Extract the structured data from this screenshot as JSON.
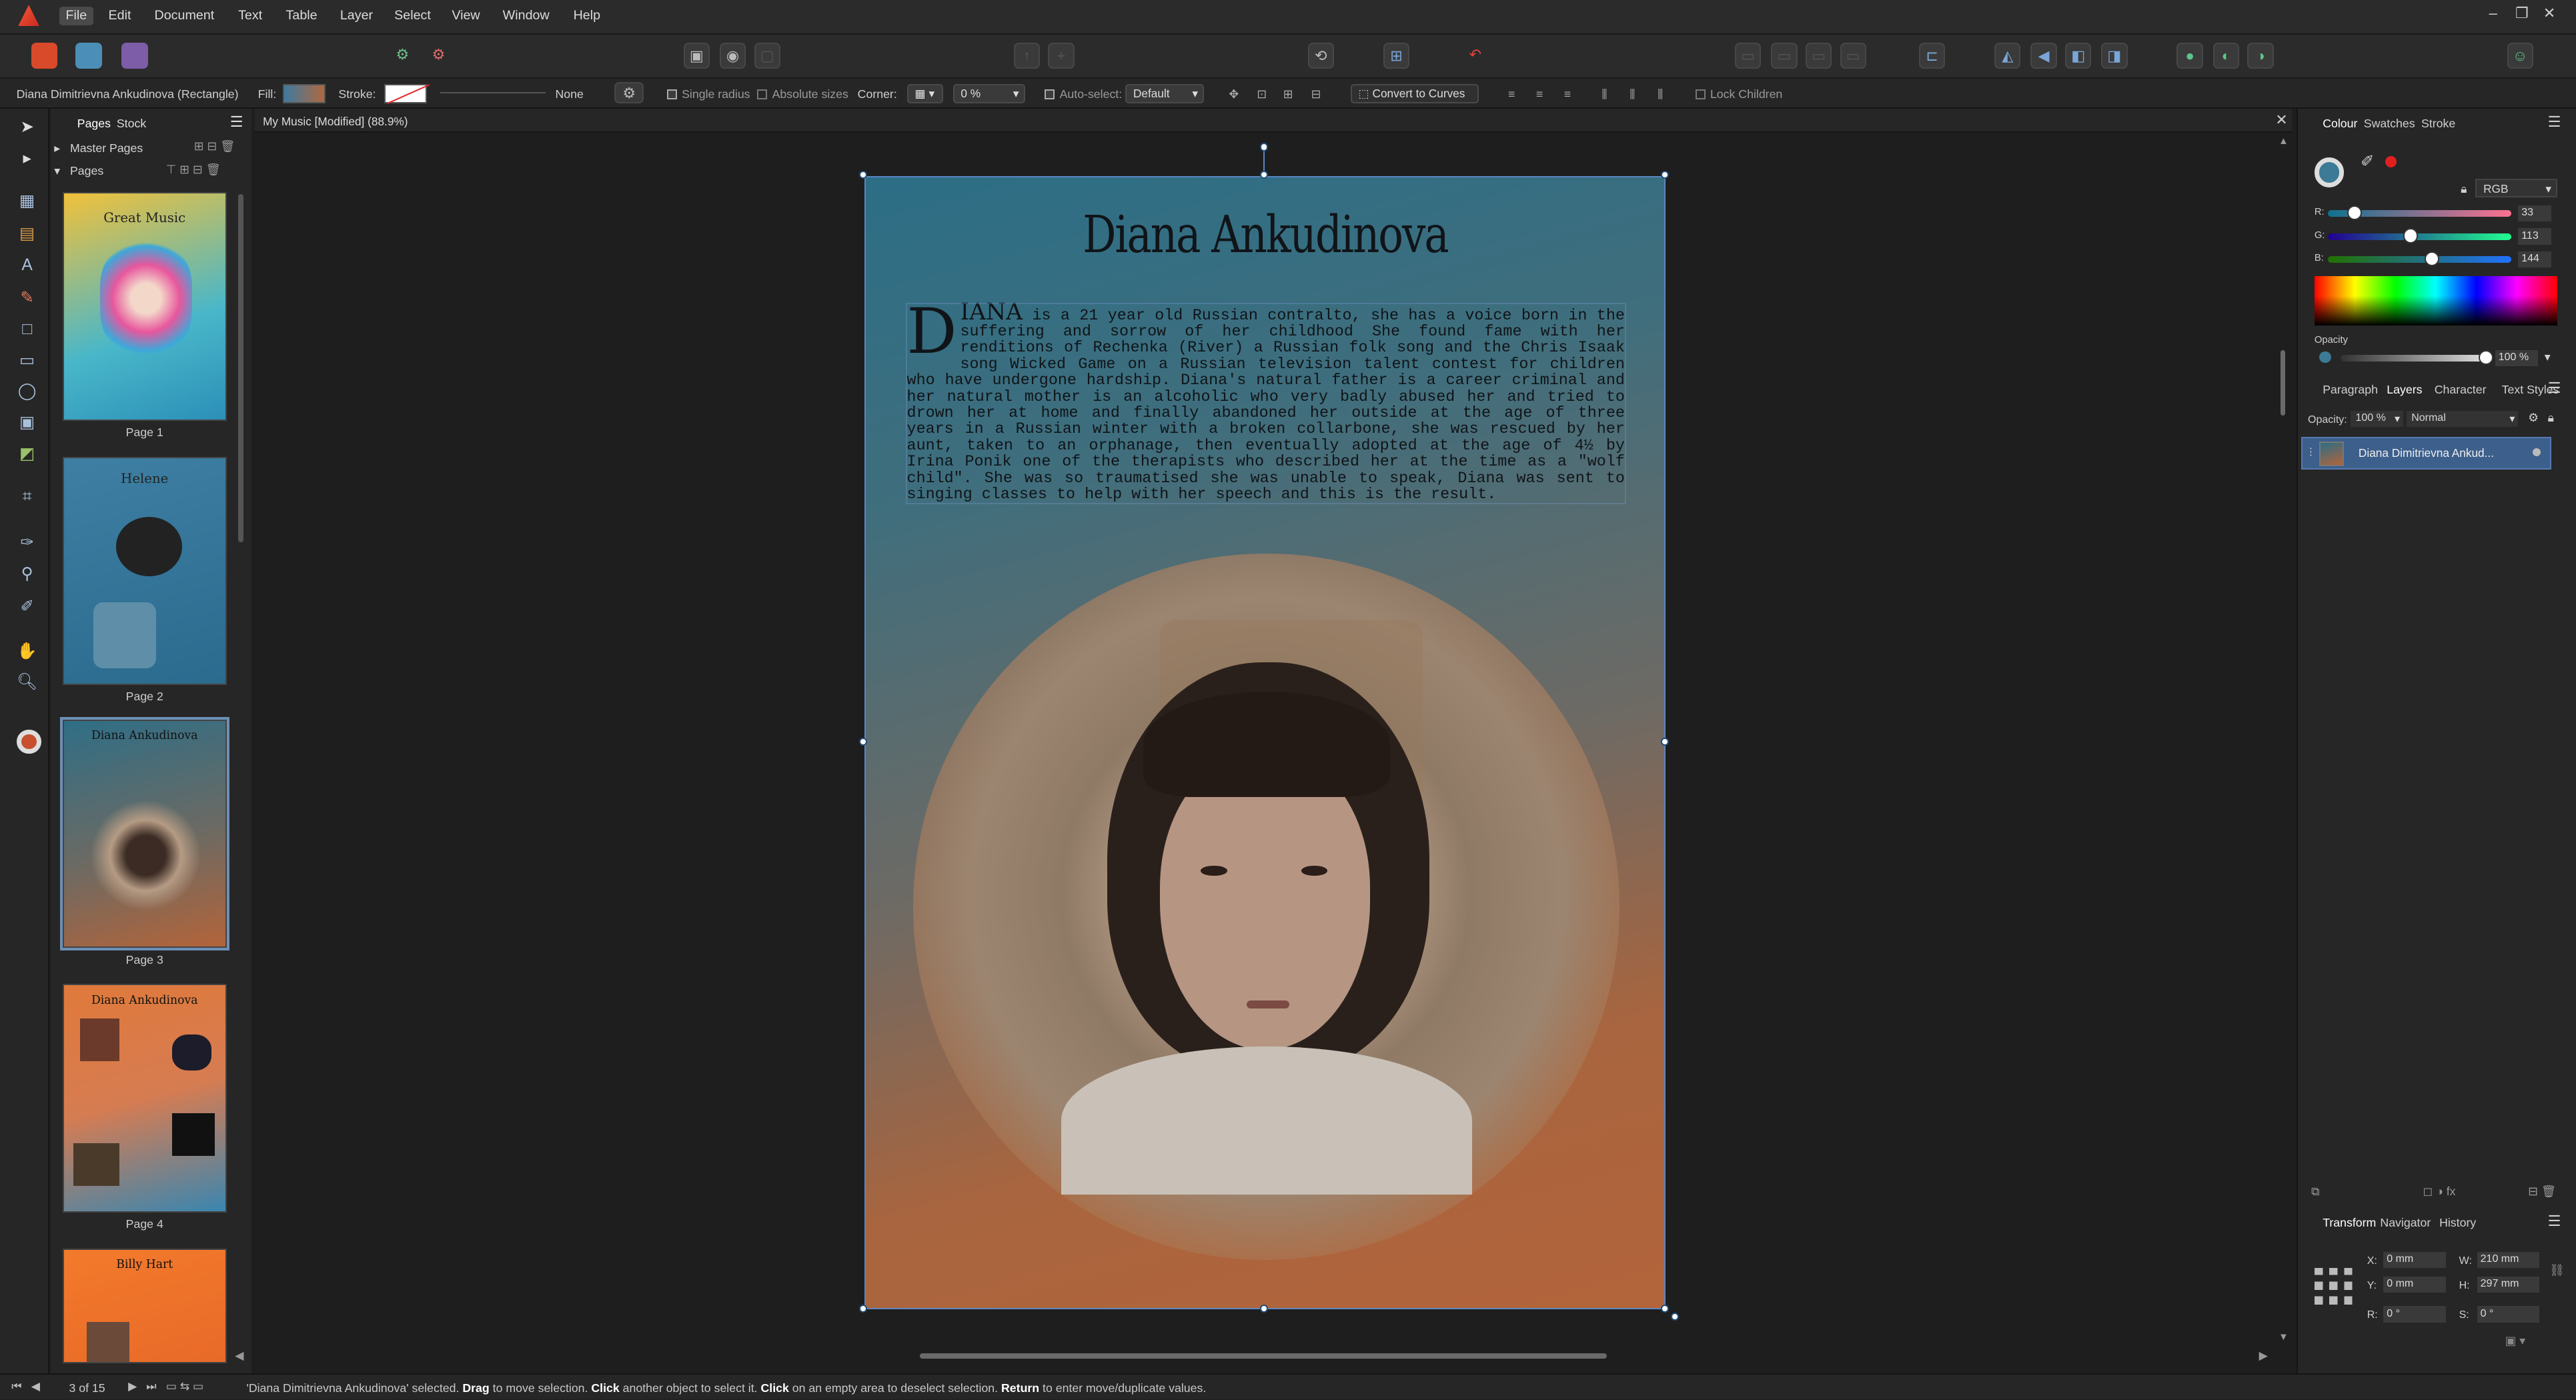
{
  "menu": {
    "items": [
      "File",
      "Edit",
      "Document",
      "Text",
      "Table",
      "Layer",
      "Select",
      "View",
      "Window",
      "Help"
    ],
    "window_controls": [
      "–",
      "❐",
      "✕"
    ]
  },
  "context": {
    "selection_name": "Diana Dimitrievna Ankudinova (Rectangle)",
    "fill_label": "Fill:",
    "stroke_label": "Stroke:",
    "stroke_none": "None",
    "single_radius": "Single radius",
    "absolute_sizes": "Absolute sizes",
    "corner_label": "Corner:",
    "corner_value": "0 %",
    "auto_select": "Auto-select:",
    "auto_select_value": "Default",
    "convert_to_curves": "Convert to Curves",
    "lock_children": "Lock Children",
    "fill_color": "#4f7fa4"
  },
  "pages_panel": {
    "tabs": [
      "Pages",
      "Stock"
    ],
    "master_pages": "Master Pages",
    "pages_label": "Pages",
    "thumbnails": [
      {
        "label": "Page 1",
        "header": "Great Music"
      },
      {
        "label": "Page 2",
        "header": "Helene"
      },
      {
        "label": "Page 3",
        "header": "Diana Ankudinova"
      },
      {
        "label": "Page 4",
        "header": "Diana Ankudinova"
      },
      {
        "label": "",
        "header": "Billy Hart"
      }
    ]
  },
  "document": {
    "tab_title": "My Music [Modified] (88.9%)",
    "page_title": "Diana Ankudinova",
    "dropcap": "D",
    "dropcap_rest": "IANA",
    "body_text": " is a 21 year old Russian contralto, she has a voice born in the suffering and sorrow of her childhood  She found fame with her renditions of Rechenka (River) a Russian folk song and the Chris Isaak song Wicked Game on a Russian television talent contest for children who have undergone hardship. Diana's natural father is a career criminal and her natural mother is an alcoholic who very badly abused her and tried to drown her at home and finally abandoned her outside at the age of three years in a Russian winter with a broken collarbone, she was rescued by her aunt, taken to an orphanage, then eventually adopted at the age of 4½ by Irina Ponik one of the therapists who described her at the time as a \"wolf child\". She was so traumatised she was unable to speak, Diana was sent to singing classes to help with her speech and this is the result."
  },
  "right_panel": {
    "colour_tabs": [
      "Colour",
      "Swatches",
      "Stroke"
    ],
    "model": "RGB",
    "r_label": "R:",
    "r": "33",
    "g_label": "G:",
    "g": "113",
    "b_label": "B:",
    "b": "144",
    "opacity_label": "Opacity",
    "opacity": "100 %",
    "layers_tabs": [
      "Paragraph",
      "Layers",
      "Character",
      "Text Styles"
    ],
    "layer_opacity_label": "Opacity:",
    "layer_opacity": "100 %",
    "blend_mode": "Normal",
    "layer_name": "Diana Dimitrievna Ankud...",
    "transform_tabs": [
      "Transform",
      "Navigator",
      "History"
    ],
    "x_label": "X:",
    "x": "0 mm",
    "y_label": "Y:",
    "y": "0 mm",
    "w_label": "W:",
    "w": "210 mm",
    "h_label": "H:",
    "h": "297 mm",
    "r_rot_label": "R:",
    "rotation": "0 °",
    "s_label": "S:",
    "shear": "0 °"
  },
  "status": {
    "page_counter": "3 of 15",
    "q1": "'Diana Dimitrievna Ankudinova'",
    "t1": " selected. ",
    "k1": "Drag",
    "t2": " to move selection. ",
    "k2": "Click",
    "t3": " another object to select it. ",
    "k3": "Click",
    "t4": " on an empty area to deselect selection. ",
    "k4": "Return",
    "t5": " to enter move/duplicate values."
  }
}
